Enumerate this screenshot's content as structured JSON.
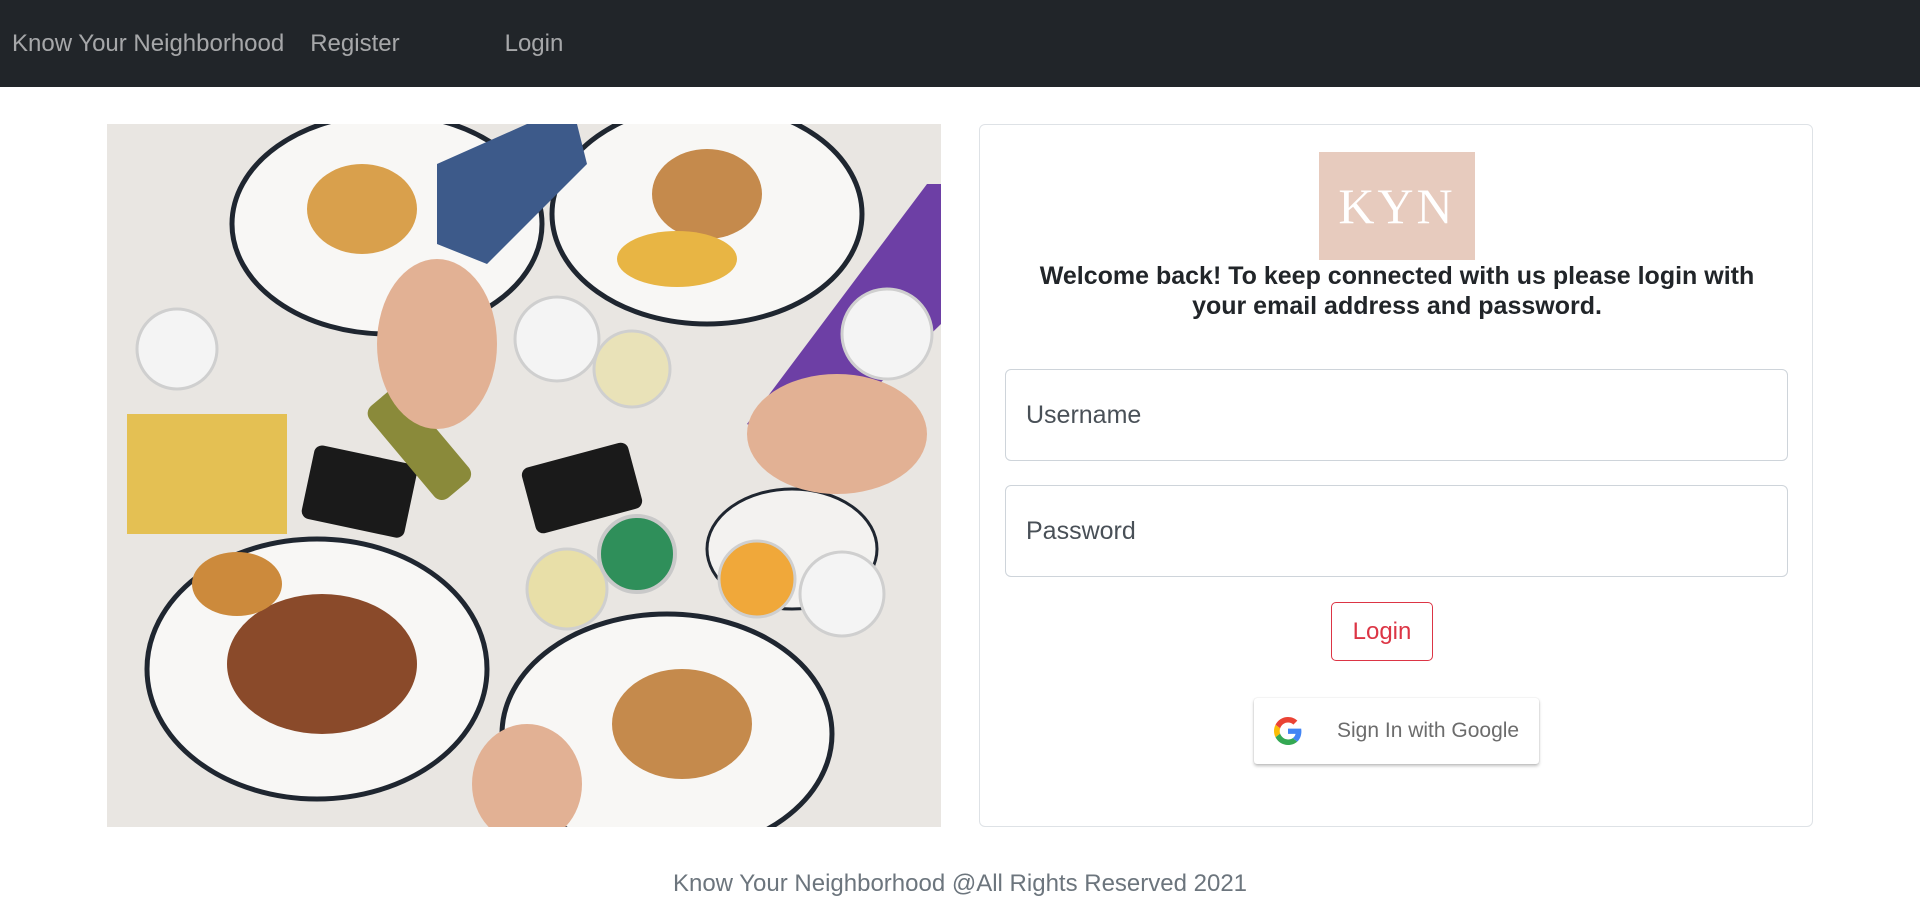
{
  "navbar": {
    "brand": "Know Your Neighborhood",
    "register_label": "Register",
    "login_label": "Login"
  },
  "logo": {
    "text": "KYN",
    "bg_color": "#e7cbbe"
  },
  "welcome_text": "Welcome back! To keep connected with us please login with your email address and password.",
  "form": {
    "username_placeholder": "Username",
    "password_placeholder": "Password",
    "login_label": "Login",
    "google_label": "Sign In with Google"
  },
  "footer": "Know Your Neighborhood @All Rights Reserved 2021",
  "colors": {
    "navbar": "#212529",
    "accent": "#dc3545"
  },
  "icons": [
    "google-icon"
  ]
}
